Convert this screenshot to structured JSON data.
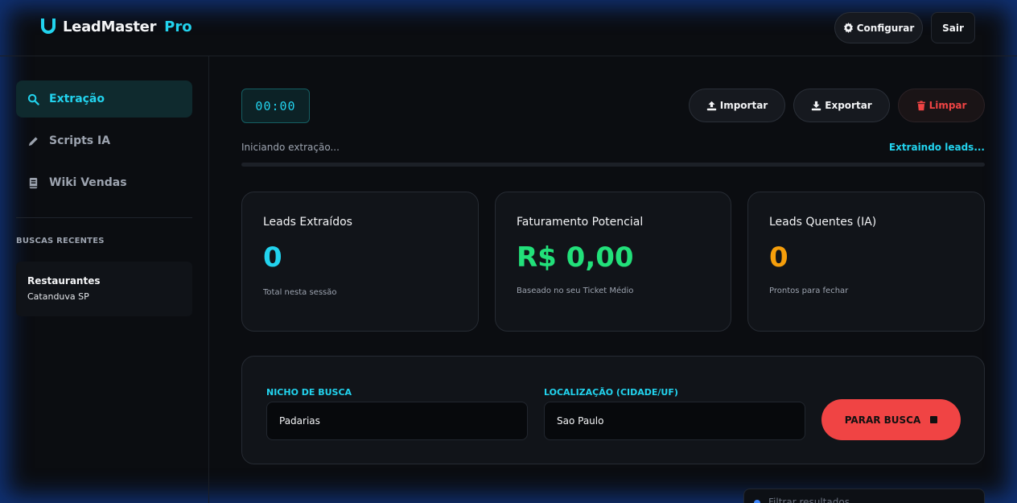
{
  "brand": {
    "name": "LeadMaster",
    "suffix": "Pro",
    "icon": "magnet-icon"
  },
  "header": {
    "config_label": "Configurar",
    "logout_label": "Sair"
  },
  "sidebar": {
    "items": [
      {
        "label": "Extração",
        "icon": "search-icon",
        "active": true
      },
      {
        "label": "Scripts IA",
        "icon": "pencil-icon",
        "active": false
      },
      {
        "label": "Wiki Vendas",
        "icon": "book-icon",
        "active": false
      }
    ],
    "recent_title": "BUSCAS RECENTES",
    "recent": [
      {
        "name": "Restaurantes",
        "location": "Catanduva SP"
      }
    ]
  },
  "toolbar": {
    "timer": "00:00",
    "import_label": "Importar",
    "export_label": "Exportar",
    "clear_label": "Limpar"
  },
  "status": {
    "left": "Iniciando extração...",
    "right": "Extraindo leads...",
    "progress": 0
  },
  "stats": [
    {
      "title": "Leads Extraídos",
      "value": "0",
      "subtitle": "Total nesta sessão",
      "color": "#22d3ee"
    },
    {
      "title": "Faturamento Potencial",
      "value": "R$ 0,00",
      "subtitle": "Baseado no seu Ticket Médio",
      "color": "#22e07a"
    },
    {
      "title": "Leads Quentes (IA)",
      "value": "0",
      "subtitle": "Prontos para fechar",
      "color": "#f59e0b"
    }
  ],
  "search": {
    "niche_label": "NICHO DE BUSCA",
    "niche_value": "Padarias",
    "location_label": "LOCALIZAÇÃO (CIDADE/UF)",
    "location_value": "Sao Paulo",
    "stop_label": "PARAR BUSCA"
  },
  "filter": {
    "placeholder": "Filtrar resultados..."
  },
  "colors": {
    "accent": "#22d3ee",
    "danger": "#ef4444",
    "background": "#0b0d11"
  }
}
